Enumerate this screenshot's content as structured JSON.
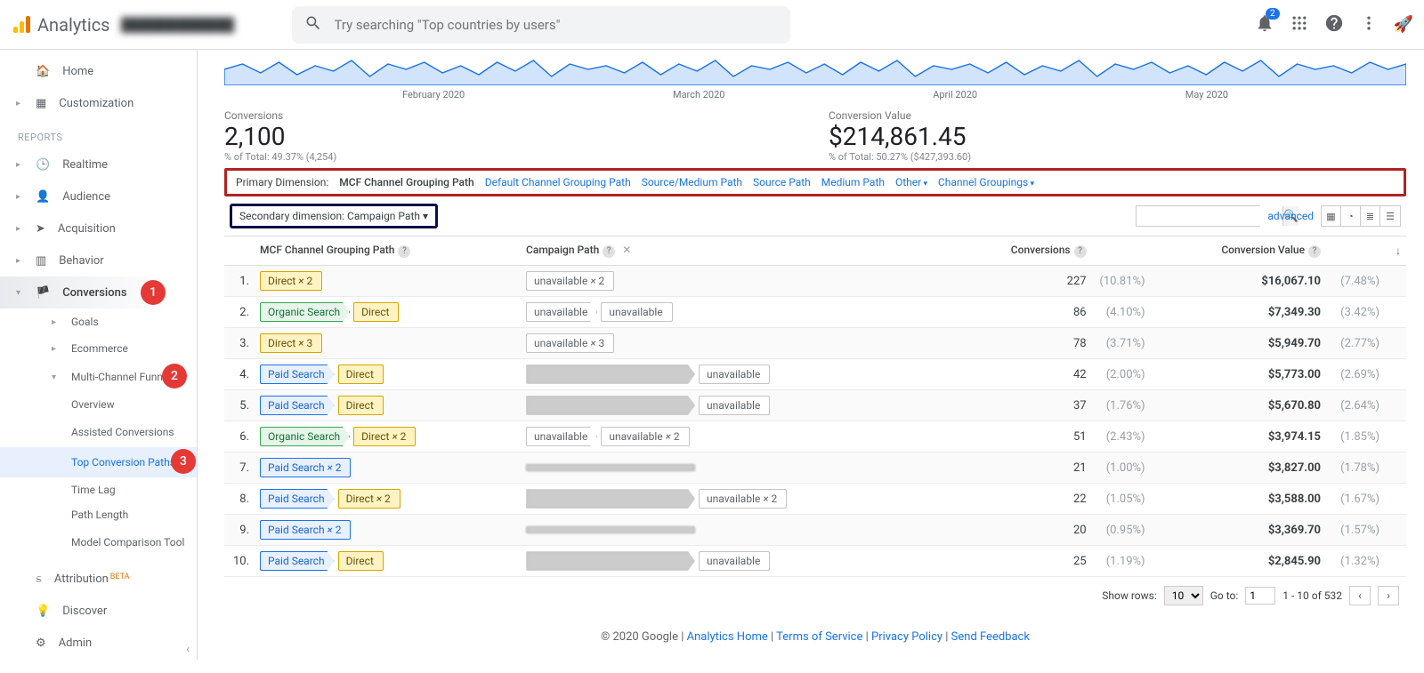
{
  "brand": "Analytics",
  "account_name": "████████████",
  "search_placeholder": "Try searching \"Top countries by users\"",
  "notification_count": "2",
  "nav": {
    "home": "Home",
    "customization": "Customization",
    "reports_label": "REPORTS",
    "realtime": "Realtime",
    "audience": "Audience",
    "acquisition": "Acquisition",
    "behavior": "Behavior",
    "conversions": "Conversions",
    "goals": "Goals",
    "ecommerce": "Ecommerce",
    "mcf": "Multi-Channel Funnels",
    "overview": "Overview",
    "assisted": "Assisted Conversions",
    "top_paths": "Top Conversion Paths",
    "time_lag": "Time Lag",
    "path_length": "Path Length",
    "model_comp": "Model Comparison Tool",
    "attribution": "Attribution",
    "beta": "BETA",
    "discover": "Discover",
    "admin": "Admin"
  },
  "badges": {
    "b1": "1",
    "b2": "2",
    "b3": "3"
  },
  "axis": {
    "m1": "February 2020",
    "m2": "March 2020",
    "m3": "April 2020",
    "m4": "May 2020"
  },
  "summary": {
    "conv_label": "Conversions",
    "conv_value": "2,100",
    "conv_sub": "% of Total: 49.37% (4,254)",
    "val_label": "Conversion Value",
    "val_value": "$214,861.45",
    "val_sub": "% of Total: 50.27% ($427,393.60)"
  },
  "dim": {
    "primary_label": "Primary Dimension:",
    "active": "MCF Channel Grouping Path",
    "d1": "Default Channel Grouping Path",
    "d2": "Source/Medium Path",
    "d3": "Source Path",
    "d4": "Medium Path",
    "d5": "Other",
    "d6": "Channel Groupings",
    "secondary": "Secondary dimension: Campaign Path"
  },
  "advanced": "advanced",
  "cols": {
    "c1": "MCF Channel Grouping Path",
    "c2": "Campaign Path",
    "c3": "Conversions",
    "c4": "Conversion Value"
  },
  "rows": [
    {
      "idx": "1.",
      "path": [
        {
          "t": "direct",
          "txt": "Direct × 2",
          "end": true
        }
      ],
      "camp": [
        {
          "t": "unavail",
          "txt": "unavailable × 2",
          "end": true
        }
      ],
      "conv": "227",
      "cpct": "(10.81%)",
      "val": "$16,067.10",
      "vpct": "(7.48%)"
    },
    {
      "idx": "2.",
      "path": [
        {
          "t": "organic",
          "txt": "Organic Search"
        },
        {
          "t": "direct",
          "txt": "Direct",
          "end": true
        }
      ],
      "camp": [
        {
          "t": "unavail",
          "txt": "unavailable"
        },
        {
          "t": "unavail",
          "txt": "unavailable",
          "end": true
        }
      ],
      "conv": "86",
      "cpct": "(4.10%)",
      "val": "$7,349.30",
      "vpct": "(3.42%)"
    },
    {
      "idx": "3.",
      "path": [
        {
          "t": "direct",
          "txt": "Direct × 3",
          "end": true
        }
      ],
      "camp": [
        {
          "t": "unavail",
          "txt": "unavailable × 3",
          "end": true
        }
      ],
      "conv": "78",
      "cpct": "(3.71%)",
      "val": "$5,949.70",
      "vpct": "(2.77%)"
    },
    {
      "idx": "4.",
      "path": [
        {
          "t": "paid",
          "txt": "Paid Search"
        },
        {
          "t": "direct",
          "txt": "Direct",
          "end": true
        }
      ],
      "camp": [
        {
          "t": "blurred",
          "txt": ""
        },
        {
          "t": "unavail",
          "txt": "unavailable",
          "end": true
        }
      ],
      "conv": "42",
      "cpct": "(2.00%)",
      "val": "$5,773.00",
      "vpct": "(2.69%)"
    },
    {
      "idx": "5.",
      "path": [
        {
          "t": "paid",
          "txt": "Paid Search"
        },
        {
          "t": "direct",
          "txt": "Direct",
          "end": true
        }
      ],
      "camp": [
        {
          "t": "blurred",
          "txt": ""
        },
        {
          "t": "unavail",
          "txt": "unavailable",
          "end": true
        }
      ],
      "conv": "37",
      "cpct": "(1.76%)",
      "val": "$5,670.80",
      "vpct": "(2.64%)"
    },
    {
      "idx": "6.",
      "path": [
        {
          "t": "organic",
          "txt": "Organic Search"
        },
        {
          "t": "direct",
          "txt": "Direct × 2",
          "end": true
        }
      ],
      "camp": [
        {
          "t": "unavail",
          "txt": "unavailable"
        },
        {
          "t": "unavail",
          "txt": "unavailable × 2",
          "end": true
        }
      ],
      "conv": "51",
      "cpct": "(2.43%)",
      "val": "$3,974.15",
      "vpct": "(1.85%)"
    },
    {
      "idx": "7.",
      "path": [
        {
          "t": "paid",
          "txt": "Paid Search × 2",
          "end": true
        }
      ],
      "camp": [
        {
          "t": "blurred",
          "txt": "",
          "end": true
        }
      ],
      "conv": "21",
      "cpct": "(1.00%)",
      "val": "$3,827.00",
      "vpct": "(1.78%)"
    },
    {
      "idx": "8.",
      "path": [
        {
          "t": "paid",
          "txt": "Paid Search"
        },
        {
          "t": "direct",
          "txt": "Direct × 2",
          "end": true
        }
      ],
      "camp": [
        {
          "t": "blurred",
          "txt": ""
        },
        {
          "t": "unavail",
          "txt": "unavailable × 2",
          "end": true
        }
      ],
      "conv": "22",
      "cpct": "(1.05%)",
      "val": "$3,588.00",
      "vpct": "(1.67%)"
    },
    {
      "idx": "9.",
      "path": [
        {
          "t": "paid",
          "txt": "Paid Search × 2",
          "end": true
        }
      ],
      "camp": [
        {
          "t": "blurred",
          "txt": "",
          "end": true
        }
      ],
      "conv": "20",
      "cpct": "(0.95%)",
      "val": "$3,369.70",
      "vpct": "(1.57%)"
    },
    {
      "idx": "10.",
      "path": [
        {
          "t": "paid",
          "txt": "Paid Search"
        },
        {
          "t": "direct",
          "txt": "Direct",
          "end": true
        }
      ],
      "camp": [
        {
          "t": "blurred",
          "txt": ""
        },
        {
          "t": "unavail",
          "txt": "unavailable",
          "end": true
        }
      ],
      "conv": "25",
      "cpct": "(1.19%)",
      "val": "$2,845.90",
      "vpct": "(1.32%)"
    }
  ],
  "pager": {
    "show_rows": "Show rows:",
    "rows_val": "10",
    "goto": "Go to:",
    "goto_val": "1",
    "range": "1 - 10 of 532"
  },
  "footer": {
    "copy": "© 2020 Google",
    "home": "Analytics Home",
    "tos": "Terms of Service",
    "priv": "Privacy Policy",
    "feed": "Send Feedback"
  }
}
